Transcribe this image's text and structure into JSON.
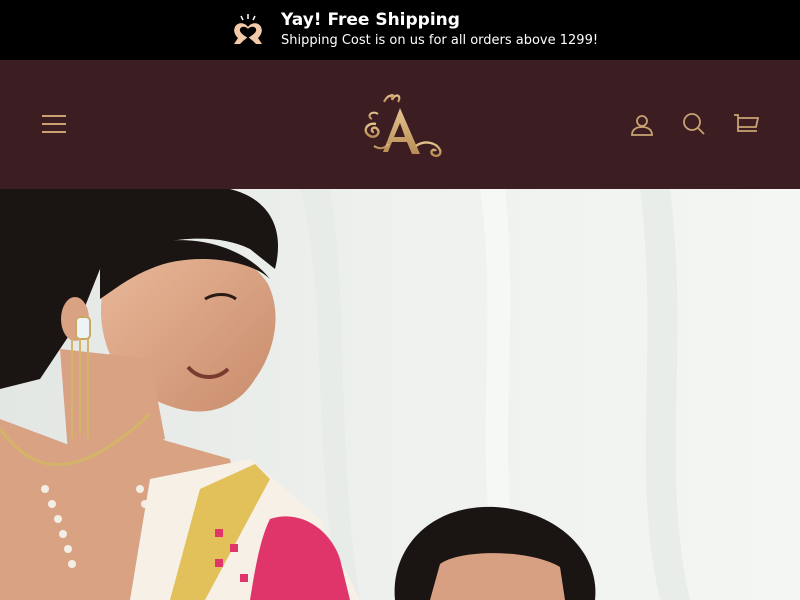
{
  "announcement": {
    "title": "Yay! Free Shipping",
    "subtitle": "Shipping Cost is on us for all orders above 1299!",
    "icon": "heart-hands-icon",
    "background": "#000000",
    "text_color": "#ffffff"
  },
  "header": {
    "background": "#3c1e22",
    "accent": "#c9a272",
    "menu_icon": "hamburger-icon",
    "logo_icon": "monogram-a-logo",
    "logo_letter": "A",
    "account_icon": "account-icon",
    "search_icon": "search-icon",
    "cart_icon": "cart-icon"
  },
  "hero": {
    "image": "hero-photo",
    "description_colors": {
      "background": "#eef0ee",
      "saree": "#f6f0e6",
      "border_gold": "#e2c05a",
      "print_pink": "#e0356a"
    }
  }
}
